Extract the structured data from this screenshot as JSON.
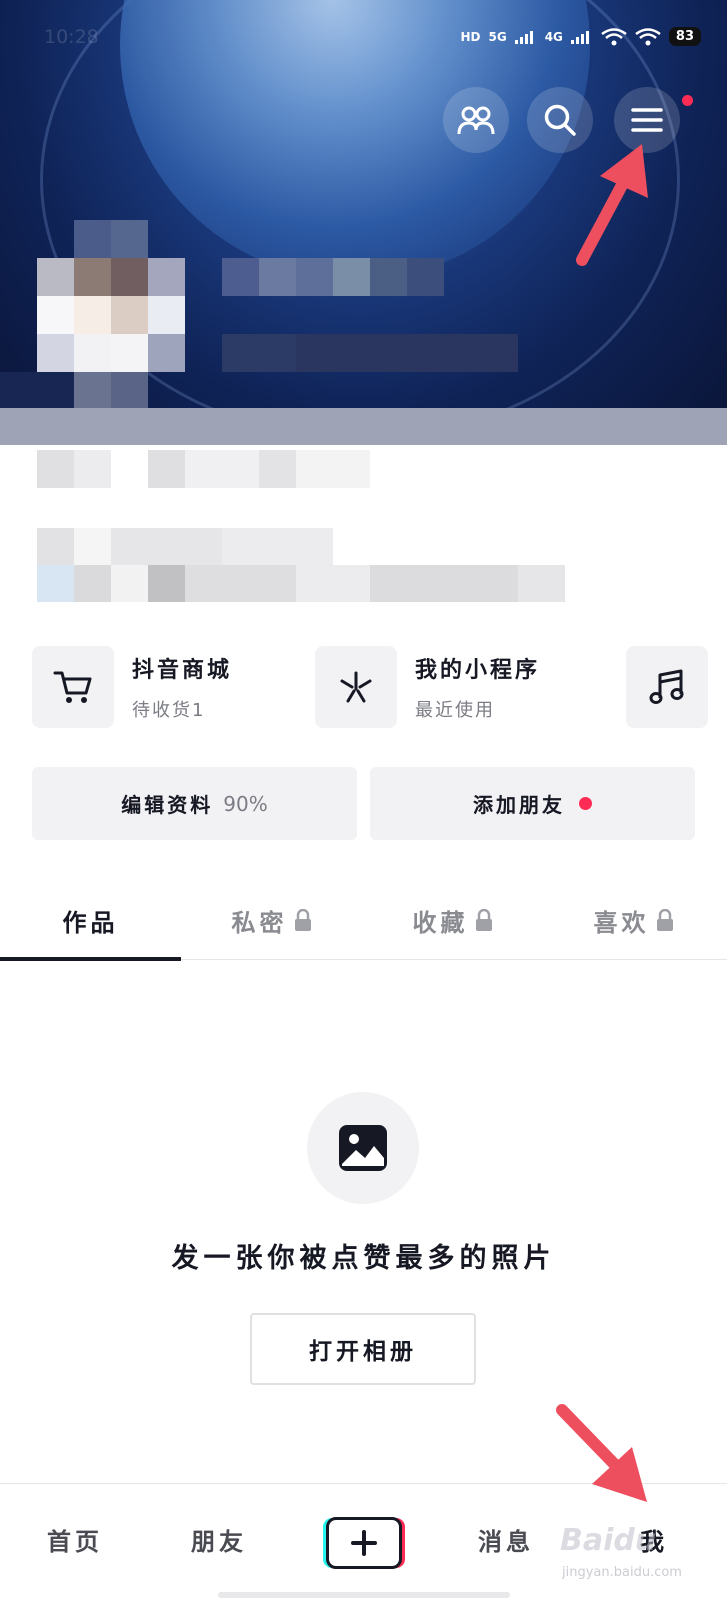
{
  "status_bar": {
    "time": "10:28",
    "indicators": [
      "HD",
      "5G",
      "4G"
    ],
    "battery": "83"
  },
  "header": {
    "buttons": [
      {
        "icon": "friends-icon"
      },
      {
        "icon": "search-icon"
      },
      {
        "icon": "menu-icon",
        "badge": true
      }
    ]
  },
  "features": [
    {
      "icon": "shopping-cart-icon",
      "title": "抖音商城",
      "subtitle": "待收货1"
    },
    {
      "icon": "mini-program-icon",
      "title": "我的小程序",
      "subtitle": "最近使用"
    },
    {
      "icon": "music-note-icon"
    }
  ],
  "actions": {
    "edit_profile": "编辑资料",
    "edit_progress": "90%",
    "add_friend": "添加朋友"
  },
  "tabs": [
    {
      "label": "作品",
      "active": true,
      "locked": false
    },
    {
      "label": "私密",
      "active": false,
      "locked": true
    },
    {
      "label": "收藏",
      "active": false,
      "locked": true
    },
    {
      "label": "喜欢",
      "active": false,
      "locked": true
    }
  ],
  "empty_state": {
    "icon": "image-icon",
    "title": "发一张你被点赞最多的照片",
    "button": "打开相册"
  },
  "bottom_nav": {
    "home": "首页",
    "friends": "朋友",
    "create": "+",
    "messages": "消息",
    "me": "我"
  },
  "watermark": {
    "brand": "Baidu",
    "sub": "jingyan.baidu.com"
  },
  "colors": {
    "accent_red": "#fe2c55",
    "accent_cyan": "#25f4ee",
    "text_primary": "#161823",
    "text_secondary": "#7b7c84",
    "card_bg": "#f2f2f4"
  }
}
